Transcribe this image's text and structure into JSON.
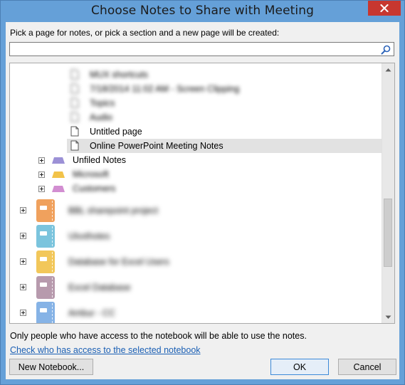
{
  "window": {
    "title": "Choose Notes to Share with Meeting"
  },
  "prompt": "Pick a page for notes, or pick a section and a new page will be created:",
  "search": {
    "value": "",
    "placeholder": ""
  },
  "tree": {
    "items": [
      {
        "kind": "page",
        "label": "MUX shortcuts",
        "blurred": true
      },
      {
        "kind": "page",
        "label": "7/18/2014 11:02 AM - Screen Clipping",
        "blurred": true
      },
      {
        "kind": "page",
        "label": "Topics",
        "blurred": true
      },
      {
        "kind": "page",
        "label": "Audio",
        "blurred": true
      },
      {
        "kind": "page",
        "label": "Untitled page",
        "blurred": false
      },
      {
        "kind": "page",
        "label": "Online PowerPoint Meeting Notes",
        "blurred": false,
        "selected": true
      },
      {
        "kind": "section",
        "label": "Unfiled Notes",
        "blurred": false,
        "color": "#9c91d6"
      },
      {
        "kind": "section",
        "label": "Microsoft",
        "blurred": true,
        "color": "#f2c34a"
      },
      {
        "kind": "section",
        "label": "Customers",
        "blurred": true,
        "color": "#d28ed1"
      },
      {
        "kind": "notebook",
        "label": "BBL sharepoint project",
        "blurred": true,
        "color": "#f0a15d"
      },
      {
        "kind": "notebook",
        "label": "Ulxxthotes",
        "blurred": true,
        "color": "#7bc4dd"
      },
      {
        "kind": "notebook",
        "label": "Database for Excel Users",
        "blurred": true,
        "color": "#f2c75a"
      },
      {
        "kind": "notebook",
        "label": "Excel Database",
        "blurred": true,
        "color": "#b79aad"
      },
      {
        "kind": "notebook",
        "label": "Ambur - CC",
        "blurred": true,
        "color": "#86b3e6"
      }
    ]
  },
  "note": "Only people who have access to the notebook will be able to use the notes.",
  "access_link": "Check who has access to the selected notebook",
  "buttons": {
    "new_notebook": "New Notebook...",
    "ok": "OK",
    "cancel": "Cancel"
  },
  "colors": {
    "titlebar": "#65a0d8",
    "close": "#c7372f",
    "link": "#1a5fb4",
    "selection": "#e2e2e2"
  }
}
